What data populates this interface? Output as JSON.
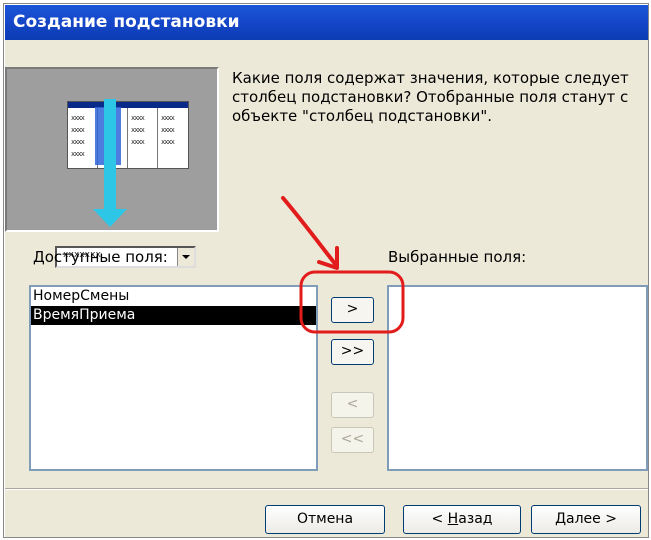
{
  "dialog": {
    "title": "Создание подстановки",
    "description": "Какие поля содержат значения, которые следует\nстолбец подстановки? Отобранные поля станут с\nобъекте \"столбец подстановки\".",
    "illustration_combo_text": "xxxxxxx"
  },
  "available": {
    "label": "Доступные поля:",
    "items": [
      "НомерСмены",
      "ВремяПриема"
    ],
    "selected_index": 1
  },
  "selected": {
    "label": "Выбранные поля:",
    "items": []
  },
  "move_buttons": {
    "add_one": ">",
    "add_all": ">>",
    "remove_one": "<",
    "remove_all": "<<"
  },
  "footer": {
    "cancel": "Отмена",
    "back_prefix": "< ",
    "back_mnemonic": "Н",
    "back_rest": "азад",
    "next_mnemonic": "Д",
    "next_rest": "алее >"
  },
  "colors": {
    "titlebar": "#1546c8",
    "annotation": "#e21b1b",
    "selection": "#000000"
  },
  "icons": {
    "illustration": "lookup-wizard-illustration",
    "annotation": "red-arrow-annotation"
  }
}
